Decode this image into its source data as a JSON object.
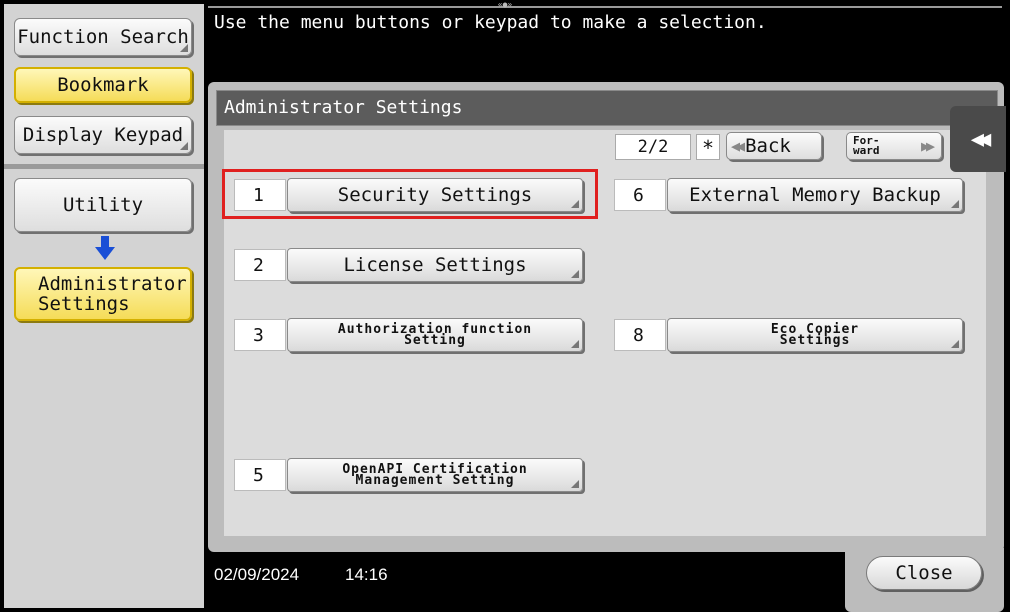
{
  "instruction": "Use the menu buttons or keypad to make a selection.",
  "sidebar": {
    "function_search": "Function Search",
    "bookmark": "Bookmark",
    "display_keypad": "Display Keypad",
    "utility": "Utility",
    "admin_line1": "Administrator",
    "admin_line2": "Settings"
  },
  "panel": {
    "title": "Administrator Settings",
    "page_indicator": "2/2",
    "star": "*",
    "back_label": "Back",
    "forward_line1": "For-",
    "forward_line2": "ward"
  },
  "items": [
    {
      "num": "1",
      "label": "Security Settings"
    },
    {
      "num": "2",
      "label": "License Settings"
    },
    {
      "num": "3",
      "line1": "Authorization function",
      "line2": "Setting"
    },
    {
      "num": "5",
      "line1": "OpenAPI Certification",
      "line2": "Management Setting"
    },
    {
      "num": "6",
      "label": "External Memory Backup"
    },
    {
      "num": "8",
      "line1": "Eco Copier",
      "line2": "Settings"
    }
  ],
  "footer": {
    "date": "02/09/2024",
    "time": "14:16",
    "close_label": "Close"
  },
  "colors": {
    "highlight": "#e0201f",
    "active_yellow": "#f5dc58",
    "header_gray": "#5c5c5c"
  },
  "icons": [
    "arrow-down-icon",
    "back-double-arrow-icon",
    "forward-double-arrow-icon",
    "collapse-panel-icon"
  ]
}
